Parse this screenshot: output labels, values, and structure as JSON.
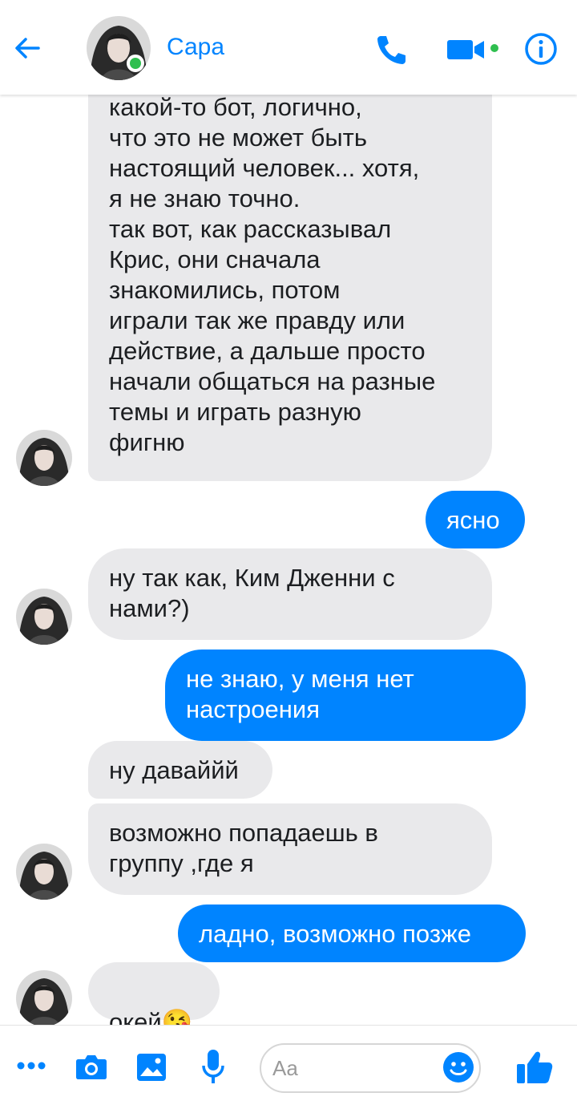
{
  "header": {
    "contact_name": "Сара",
    "icons": [
      "back-arrow-icon",
      "phone-icon",
      "video-camera-icon",
      "info-icon"
    ],
    "online": true,
    "accent_color": "#0084ff"
  },
  "messages": [
    {
      "from": "contact",
      "text": "какой-то бот, логично,\nчто это не может быть\nнастоящий человек... хотя,\nя не знаю точно.\nтак вот, как рассказывал\nКрис, они сначала\nзнакомились, потом\nиграли так же правду или\nдействие, а дальше просто\nначали общаться на разные\nтемы и играть разную\nфигню"
    },
    {
      "from": "me",
      "text": "ясно"
    },
    {
      "from": "contact",
      "text": "ну так как, Ким Дженни с\nнами?)"
    },
    {
      "from": "me",
      "text": "не знаю, у меня нет\nнастроения"
    },
    {
      "from": "contact",
      "text": "ну даваййй"
    },
    {
      "from": "contact",
      "text": "возможно попадаешь в\nгруппу ,где я"
    },
    {
      "from": "me",
      "text": "ладно, возможно позже"
    },
    {
      "from": "contact",
      "text": "окей",
      "emoji": "😘"
    }
  ],
  "composer": {
    "placeholder": "Aa",
    "icons": [
      "more-icon",
      "camera-icon",
      "image-icon",
      "microphone-icon",
      "emoji-icon",
      "thumbs-up-icon"
    ]
  }
}
